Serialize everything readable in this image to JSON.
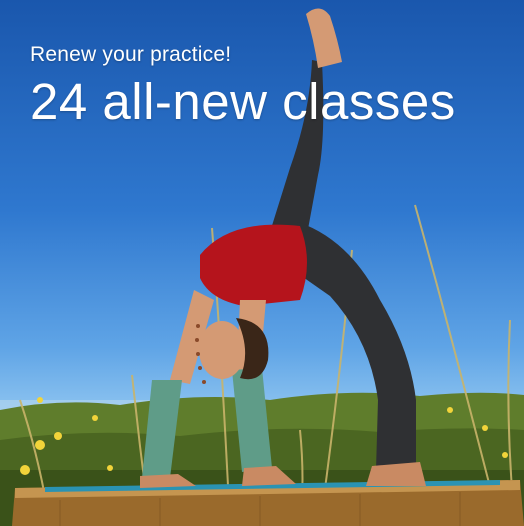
{
  "banner": {
    "subtitle": "Renew your practice!",
    "title": "24 all-new classes"
  },
  "colors": {
    "sky_top": "#1a57ad",
    "sky_horizon": "#9ccaf0",
    "grass": "#5f7d2c",
    "shirt": "#b5141c",
    "pants": "#2f3033",
    "leg_warmers": "#5f9c88",
    "mat": "#2a93b3",
    "platform": "#9a6a2c"
  }
}
